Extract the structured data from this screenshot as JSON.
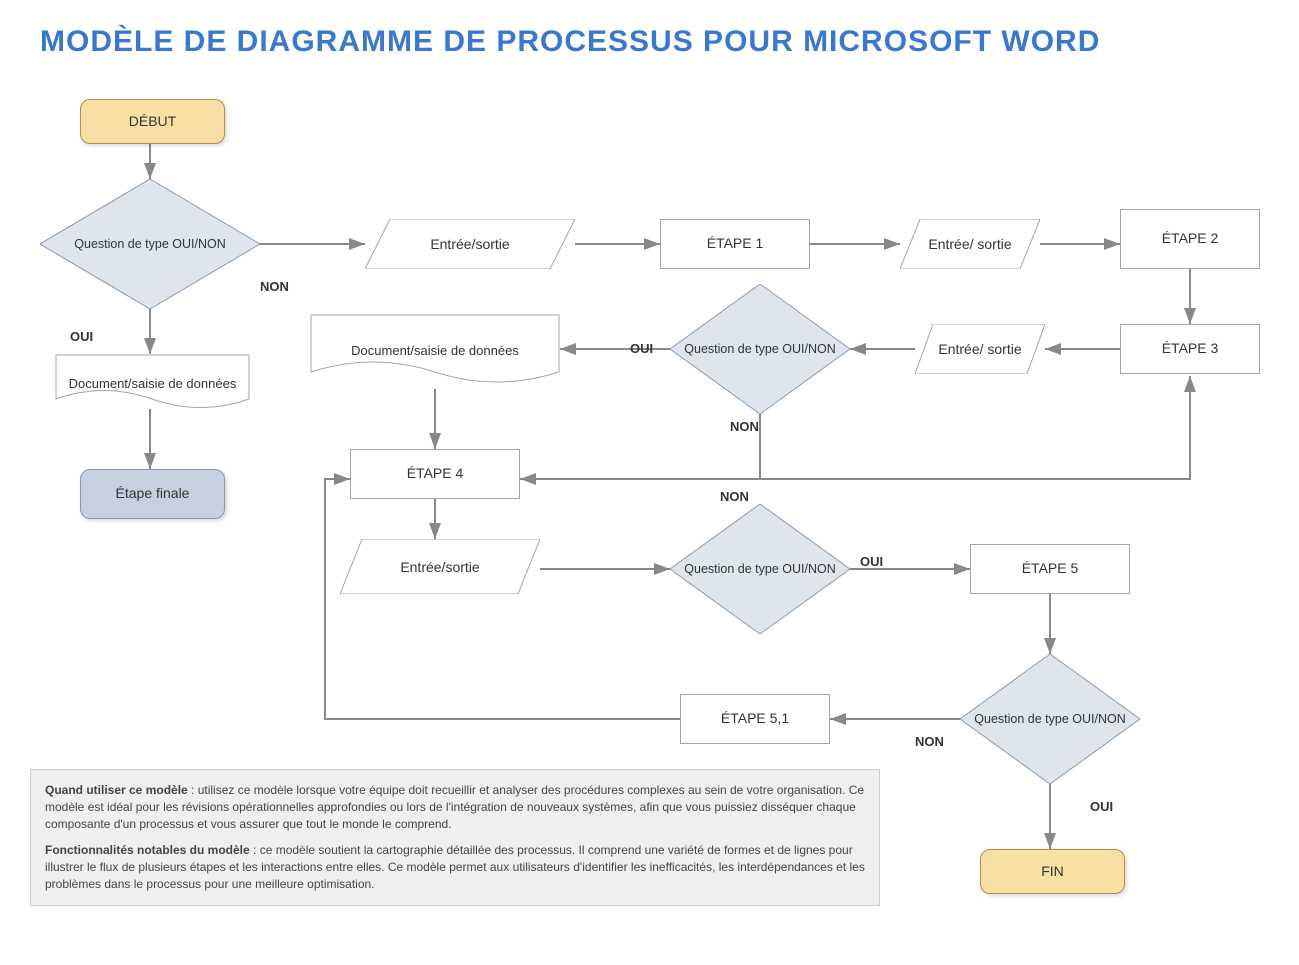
{
  "title": "MODÈLE DE DIAGRAMME DE PROCESSUS POUR MICROSOFT WORD",
  "nodes": {
    "start": "DÉBUT",
    "q1": "Question de type OUI/NON",
    "oui": "OUI",
    "non": "NON",
    "io1": "Entrée/sortie",
    "step1": "ÉTAPE 1",
    "io2": "Entrée/ sortie",
    "step2": "ÉTAPE 2",
    "step3": "ÉTAPE 3",
    "io3": "Entrée/ sortie",
    "q2": "Question de type OUI/NON",
    "doc1": "Document/saisie de données",
    "doc2": "Document/saisie de données",
    "finalstep": "Étape finale",
    "step4": "ÉTAPE 4",
    "io4": "Entrée/sortie",
    "q3": "Question de type OUI/NON",
    "step5": "ÉTAPE 5",
    "q4": "Question de type OUI/NON",
    "step51": "ÉTAPE 5,1",
    "fin": "FIN"
  },
  "info": {
    "p1_label": "Quand utiliser ce modèle",
    "p1_text": " : utilisez ce modèle lorsque votre équipe doit recueillir et analyser des procédures complexes au sein de votre organisation. Ce modèle est idéal pour les révisions opérationnelles approfondies ou lors de l'intégration de nouveaux systèmes, afin que vous puissiez disséquer chaque composante d'un processus et vous assurer que tout le monde le comprend.",
    "p2_label": "Fonctionnalités notables du modèle",
    "p2_text": " : ce modèle soutient la cartographie détaillée des processus. Il comprend une variété de formes et de lignes pour illustrer le flux de plusieurs étapes et les interactions entre elles. Ce modèle permet aux utilisateurs d'identifier les inefficacités, les interdépendances et les problèmes dans le processus pour une meilleure optimisation."
  }
}
